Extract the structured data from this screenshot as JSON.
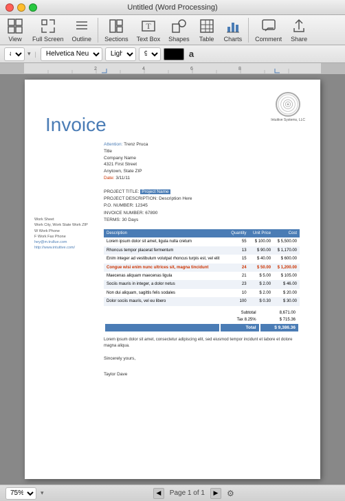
{
  "titlebar": {
    "title": "Untitled (Word Processing)"
  },
  "toolbar": {
    "items": [
      {
        "id": "view",
        "label": "View",
        "icon": "⊞"
      },
      {
        "id": "fullscreen",
        "label": "Full Screen",
        "icon": "⛶"
      },
      {
        "id": "outline",
        "label": "Outline",
        "icon": "☰"
      },
      {
        "id": "sections",
        "label": "Sections",
        "icon": "▦"
      },
      {
        "id": "textbox",
        "label": "Text Box",
        "icon": "T"
      },
      {
        "id": "shapes",
        "label": "Shapes",
        "icon": "◻"
      },
      {
        "id": "table",
        "label": "Table",
        "icon": "⊞"
      },
      {
        "id": "charts",
        "label": "Charts",
        "icon": "📊"
      },
      {
        "id": "comment",
        "label": "Comment",
        "icon": "💬"
      },
      {
        "id": "share",
        "label": "Share",
        "icon": "⬆"
      }
    ]
  },
  "formatbar": {
    "style": "a",
    "font": "Helvetica Neue",
    "weight": "Light",
    "size": "9",
    "color_label": "a"
  },
  "document": {
    "logo_company": "Intuitive Systems, LLC",
    "invoice_title": "Invoice",
    "attention_label": "Attention:",
    "attention_value": "Trenz Pruca",
    "title_label": "Title",
    "company_name": "Company Name",
    "address1": "4321 First Street",
    "address2": "Anytown, State ZIP",
    "date_label": "Date:",
    "date_value": "3/11/11",
    "left_col": {
      "workheet": "Work Sheet",
      "city": "Work City, Work State Work ZIP",
      "work_phone": "W Work Phone",
      "fax": "F Work Fax Phone",
      "email": "hey@m.trullue.com",
      "website": "http://www.intuitive.com/"
    },
    "project_title_label": "PROJECT TITLE:",
    "project_title_value": "Project Name",
    "project_desc_label": "PROJECT DESCRIPTION:",
    "project_desc_value": "Description Here",
    "po_number": "P.O. NUMBER: 12345",
    "invoice_number": "INVOICE NUMBER: 67890",
    "terms": "TERMS: 30 Days",
    "table": {
      "headers": [
        "Description",
        "Quantity",
        "Unit Price",
        "Cost"
      ],
      "rows": [
        {
          "desc": "Lorem ipsum dolor sit amet, ligula nulla cretum",
          "qty": "55",
          "unit": "$ 100.00",
          "cost": "$ 5,500.00"
        },
        {
          "desc": "Rhoncus tempor placerat fermentum",
          "qty": "13",
          "unit": "$ 90.00",
          "cost": "$ 1,170.00"
        },
        {
          "desc": "Enim integer ad vestibulum volutpat rhoncus turpis est, vel elit",
          "qty": "15",
          "unit": "$ 40.00",
          "cost": "$ 600.00"
        },
        {
          "desc": "Congue wisi enim nunc ultrices sit, magna tincidunt",
          "qty": "24",
          "unit": "$ 50.00",
          "cost": "$ 1,200.00",
          "bold": true
        },
        {
          "desc": "Maecenas aliquam maecenas ligula",
          "qty": "21",
          "unit": "$ 5.00",
          "cost": "$ 105.00"
        },
        {
          "desc": "Sociis mauris in integer, a dolor netus",
          "qty": "23",
          "unit": "$ 2.00",
          "cost": "$ 46.00"
        },
        {
          "desc": "Non dui aliquam, sagittis felis sodales",
          "qty": "10",
          "unit": "$ 2.00",
          "cost": "$ 20.00"
        },
        {
          "desc": "Dolor sociis mauris, vel eu libero",
          "qty": "100",
          "unit": "$ 0.30",
          "cost": "$ 30.00"
        }
      ],
      "subtotal_label": "Subtotal",
      "subtotal_value": "8,671.00",
      "tax_label": "Tax 8.25%",
      "tax_value": "$ 715.36",
      "total_label": "Total",
      "total_value": "$ 9,386.36"
    },
    "footer_text": "Lorem ipsum dolor sit amet, consectetur adipiscing elit, sed eiusmod tempor incidunt et labore et dolore magna aliqua.",
    "closing": "Sincerely yours,",
    "signature": "Taylor Dave"
  },
  "bottombar": {
    "zoom": "75%",
    "page_info": "Page 1 of 1"
  }
}
